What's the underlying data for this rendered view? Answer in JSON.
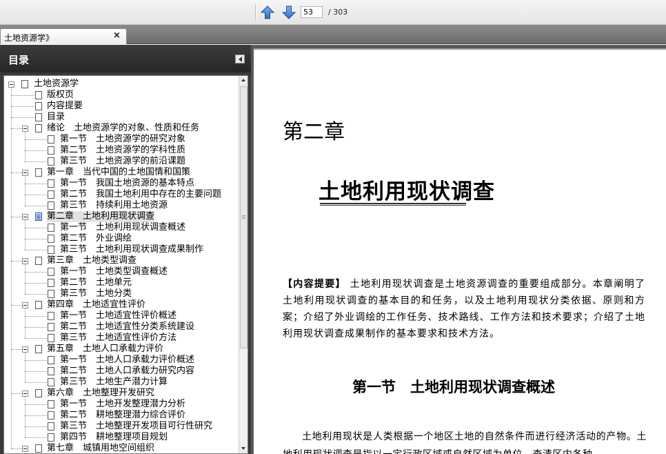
{
  "toolbar": {
    "prev_icon": "up-arrow-icon",
    "next_icon": "down-arrow-icon",
    "current_page": "53",
    "total_pages": "/ 303"
  },
  "tab": {
    "title": "土地资源学》",
    "close": "×"
  },
  "sidebar": {
    "title": "目录",
    "outline": [
      {
        "label": "土地资源学",
        "level": 0,
        "expandable": true
      },
      {
        "label": "版权页",
        "level": 1
      },
      {
        "label": "内容提要",
        "level": 1
      },
      {
        "label": "目录",
        "level": 1
      },
      {
        "label": "绪论　土地资源学的对象、性质和任务",
        "level": 1,
        "expandable": true
      },
      {
        "label": "第一节　土地资源学的研究对象",
        "level": 2
      },
      {
        "label": "第二节　土地资源学的学科性质",
        "level": 2
      },
      {
        "label": "第三节　土地资源学的前沿课题",
        "level": 2
      },
      {
        "label": "第一章　当代中国的土地国情和国策",
        "level": 1,
        "expandable": true
      },
      {
        "label": "第一节　我国土地资源的基本特点",
        "level": 2
      },
      {
        "label": "第二节　我国土地利用中存在的主要问题",
        "level": 2
      },
      {
        "label": "第三节　持续利用土地资源",
        "level": 2
      },
      {
        "label": "第二章　土地利用现状调查",
        "level": 1,
        "expandable": true,
        "selected": true
      },
      {
        "label": "第一节　土地利用现状调查概述",
        "level": 2
      },
      {
        "label": "第二节　外业调绘",
        "level": 2
      },
      {
        "label": "第三节　土地利用现状调查成果制作",
        "level": 2
      },
      {
        "label": "第三章　土地类型调查",
        "level": 1,
        "expandable": true
      },
      {
        "label": "第一节　土地类型调查概述",
        "level": 2
      },
      {
        "label": "第二节　土地单元",
        "level": 2
      },
      {
        "label": "第三节　土地分类",
        "level": 2
      },
      {
        "label": "第四章　土地适宜性评价",
        "level": 1,
        "expandable": true
      },
      {
        "label": "第一节　土地适宜性评价概述",
        "level": 2
      },
      {
        "label": "第二节　土地适宜性分类系统建设",
        "level": 2
      },
      {
        "label": "第三节　土地适宜性评价方法",
        "level": 2
      },
      {
        "label": "第五章　土地人口承载力评价",
        "level": 1,
        "expandable": true
      },
      {
        "label": "第一节　土地人口承载力评价概述",
        "level": 2
      },
      {
        "label": "第二节　土地人口承载力研究内容",
        "level": 2
      },
      {
        "label": "第三节　土地生产潜力计算",
        "level": 2
      },
      {
        "label": "第六章　土地整理开发研究",
        "level": 1,
        "expandable": true
      },
      {
        "label": "第一节　土地开发整理潜力分析",
        "level": 2
      },
      {
        "label": "第二节　耕地整理潜力综合评价",
        "level": 2
      },
      {
        "label": "第三节　土地整理开发项目可行性研究",
        "level": 2
      },
      {
        "label": "第四节　耕地整理项目规划",
        "level": 2
      },
      {
        "label": "第七章　城镇用地空间组织",
        "level": 1,
        "expandable": true
      }
    ]
  },
  "document": {
    "chapter": "第二章",
    "chapter_title": "土地利用现状调查",
    "summary_label": "【内容提要】",
    "summary_text": " 土地利用现状调查是土地资源调查的重要组成部分。本章阐明了土地利用现状调查的基本目的和任务，以及土地利用现状分类依据、原则和方案；介绍了外业调绘的工作任务、技术路线、工作方法和技术要求；介绍了土地利用现状调查成果制作的基本要求和技术方法。",
    "section_title": "第一节　土地利用现状调查概述",
    "body_text": "土地利用现状是人类根据一个地区土地的自然条件而进行经济活动的产物。土地利用现状调查是指以一定行政区域或自然区域为单位，查清区内各种"
  }
}
